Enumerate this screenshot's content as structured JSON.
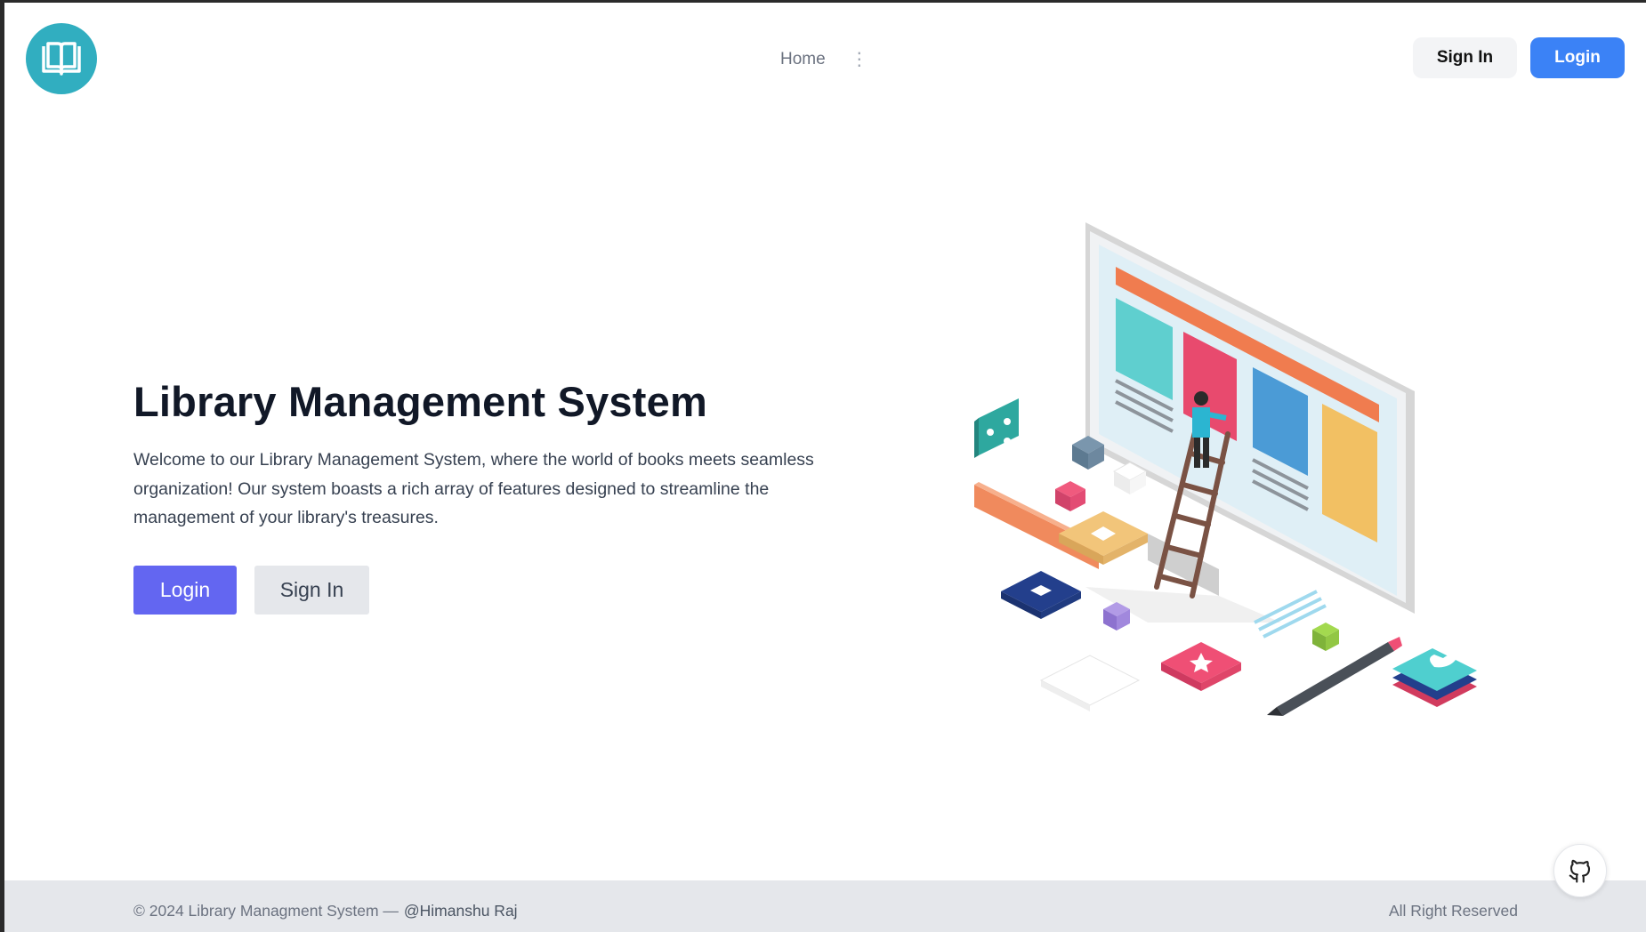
{
  "header": {
    "logo_icon": "open-book-icon",
    "nav": {
      "home_label": "Home",
      "more_icon": "vertical-ellipsis-icon"
    },
    "signin_label": "Sign In",
    "login_label": "Login"
  },
  "hero": {
    "title": "Library Management System",
    "description": "Welcome to our Library Management System, where the world of books meets seamless organization! Our system boasts a rich array of features designed to streamline the management of your library's treasures.",
    "login_label": "Login",
    "signin_label": "Sign In",
    "illustration_icon": "isometric-computer-illustration"
  },
  "footer": {
    "copyright": "© 2024 Library Managment System —",
    "author": "@Himanshu Raj",
    "rights": "All Right Reserved"
  },
  "floating": {
    "github_icon": "github-icon"
  },
  "colors": {
    "logo_bg": "#31aec0",
    "header_login_bg": "#3b82f6",
    "hero_login_bg": "#6366f1",
    "secondary_bg": "#e5e7eb"
  }
}
